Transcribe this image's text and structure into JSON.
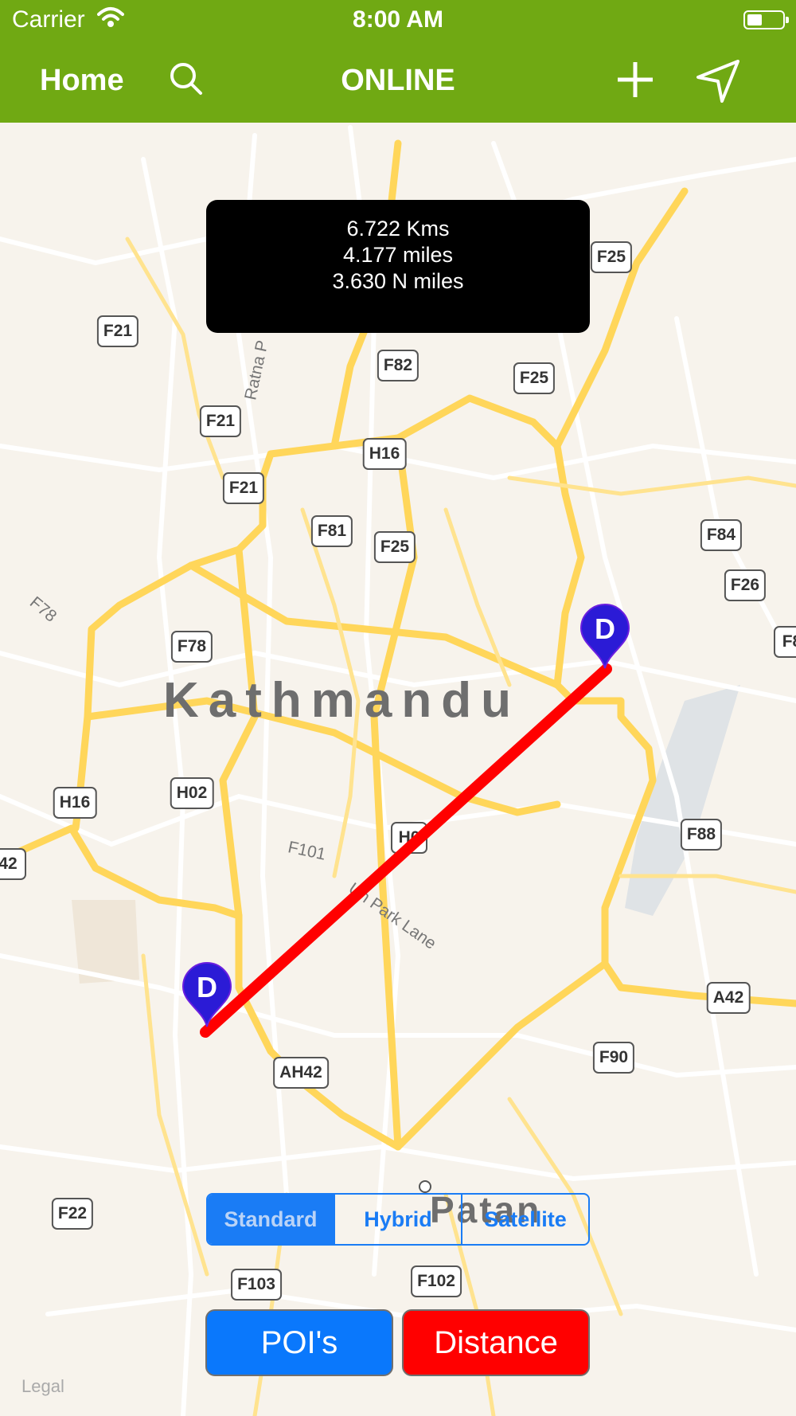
{
  "status_bar": {
    "carrier": "Carrier",
    "time": "8:00 AM"
  },
  "nav": {
    "home": "Home",
    "title": "ONLINE"
  },
  "distance_overlay": {
    "kms": "6.722 Kms",
    "miles": "4.177 miles",
    "nmiles": "3.630 N miles"
  },
  "map": {
    "city": "Kathmandu",
    "city2": "Patan",
    "road_labels": [
      "Ratna P",
      "F78",
      "F101",
      "Un Park Lane"
    ],
    "shields": [
      "F25",
      "F21",
      "F82",
      "F25",
      "F21",
      "H16",
      "F21",
      "F81",
      "F25",
      "F84",
      "F26",
      "F8",
      "F78",
      "H16",
      "H02",
      "H0",
      "42",
      "F88",
      "A42",
      "AH42",
      "F90",
      "F22",
      "F103",
      "F102"
    ],
    "pin_letter": "D",
    "route_color": "#ff0000",
    "legal": "Legal"
  },
  "map_type": {
    "options": [
      "Standard",
      "Hybrid",
      "Satellite"
    ],
    "selected": "Standard"
  },
  "buttons": {
    "pois": "POI's",
    "distance": "Distance"
  },
  "colors": {
    "nav": "#70a913",
    "accent": "#1a7cf5",
    "pois_button": "#0a78fc",
    "distance_button": "#ff0000"
  }
}
